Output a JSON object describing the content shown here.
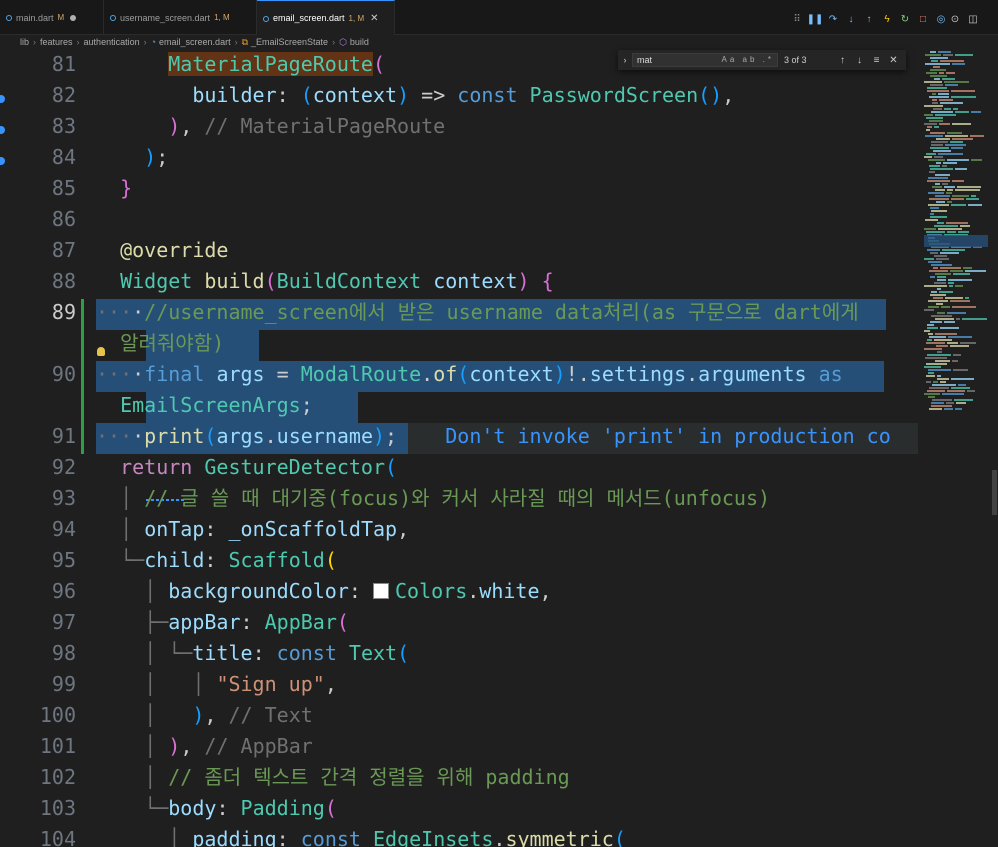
{
  "tabs": [
    {
      "name": "main.dart",
      "status": "M",
      "active": false,
      "dirty": true
    },
    {
      "name": "username_screen.dart",
      "status": "1, M",
      "active": false,
      "dirty": false
    },
    {
      "name": "email_screen.dart",
      "status": "1, M",
      "active": true,
      "dirty": false
    }
  ],
  "breadcrumb": {
    "parts": [
      "lib",
      "features",
      "authentication",
      "email_screen.dart",
      "_EmailScreenState",
      "build"
    ]
  },
  "find": {
    "query": "mat",
    "options": "Aa ab .*",
    "count": "3 of 3"
  },
  "editor": {
    "current_line": "89",
    "lines": [
      {
        "n": "81"
      },
      {
        "n": "82"
      },
      {
        "n": "83"
      },
      {
        "n": "84"
      },
      {
        "n": "85"
      },
      {
        "n": "86"
      },
      {
        "n": "87"
      },
      {
        "n": "88"
      },
      {
        "n": "89"
      },
      {
        "n": "90"
      },
      {
        "n": "91"
      },
      {
        "n": "92"
      },
      {
        "n": "93"
      },
      {
        "n": "94"
      },
      {
        "n": "95"
      },
      {
        "n": "96"
      },
      {
        "n": "97"
      },
      {
        "n": "98"
      },
      {
        "n": "99"
      },
      {
        "n": "100"
      },
      {
        "n": "101"
      },
      {
        "n": "102"
      },
      {
        "n": "103"
      },
      {
        "n": "104"
      }
    ],
    "tokens": {
      "l81_1": "MaterialPageRoute",
      "l82_1": "builder",
      "l82_2": "context",
      "l82_3": "const",
      "l82_4": "PasswordScreen",
      "l83_1": "// MaterialPageRoute",
      "l87_1": "@override",
      "l88_1": "Widget",
      "l88_2": "build",
      "l88_3": "BuildContext",
      "l88_4": "context",
      "l89_1": "//username_screen에서 받은 username data처리(as 구문으로 dart에게",
      "l89_2": "알려줘야함)",
      "l90_1": "final",
      "l90_2": "args",
      "l90_3": "ModalRoute",
      "l90_4": "of",
      "l90_5": "context",
      "l90_6": "settings",
      "l90_7": "arguments",
      "l90_8": "as",
      "l90_9": "EmailScreenArgs",
      "l91_1": "print",
      "l91_2": "args",
      "l91_3": "username",
      "l91_hint": "Don't invoke 'print' in production co",
      "l92_1": "return",
      "l92_2": "GestureDetector",
      "l93_1": "// 글 쓸 때 대기중(focus)와 커서 사라질 때의 메서드(unfocus)",
      "l94_1": "onTap",
      "l94_2": "_onScaffoldTap",
      "l95_1": "child",
      "l95_2": "Scaffold",
      "l96_1": "backgroundColor",
      "l96_2": "Colors",
      "l96_3": "white",
      "l97_1": "appBar",
      "l97_2": "AppBar",
      "l98_1": "title",
      "l98_2": "const",
      "l98_3": "Text",
      "l99_1": "\"Sign up\"",
      "l100_1": "// Text",
      "l101_1": "// AppBar",
      "l102_1": "// 좀더 텍스트 간격 정렬을 위해 padding",
      "l103_1": "body",
      "l103_2": "Padding",
      "l104_1": "padding",
      "l104_2": "const",
      "l104_3": "EdgeInsets",
      "l104_4": "symmetric"
    }
  },
  "colors": {
    "background": "#1f1f1f",
    "selection": "#264f78",
    "keyword": "#569cd6",
    "comment": "#6a9955",
    "type": "#4ec9b0",
    "function": "#dcdcaa",
    "variable": "#9cdcfe",
    "string": "#ce9178",
    "accent": "#3794ff"
  }
}
